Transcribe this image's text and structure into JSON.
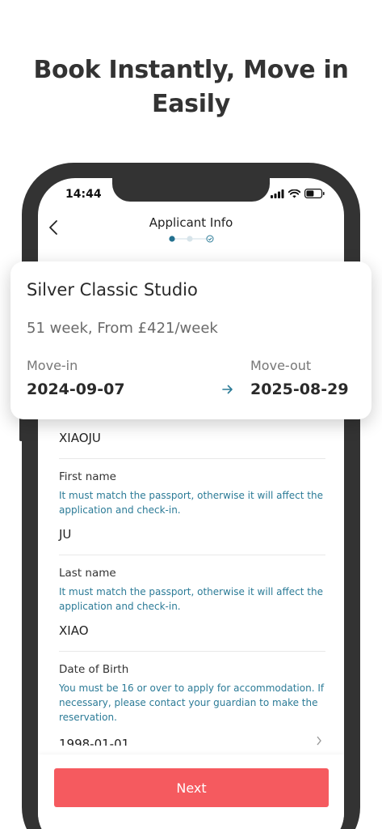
{
  "headline": {
    "line1": "Book Instantly, Move in",
    "line2": "Easily"
  },
  "status_bar": {
    "time": "14:44",
    "icons": [
      "signal-icon",
      "wifi-icon",
      "battery-icon"
    ]
  },
  "nav": {
    "title": "Applicant Info",
    "back_icon": "chevron-left-icon",
    "steps": [
      "step-1-current",
      "step-2",
      "step-3-check"
    ]
  },
  "card": {
    "title": "Silver Classic Studio",
    "subtitle": "51 week, From £421/week",
    "move_in_label": "Move-in",
    "move_in_date": "2024-09-07",
    "move_out_label": "Move-out",
    "move_out_date": "2025-08-29",
    "arrow_icon": "arrow-right-icon"
  },
  "form": {
    "name_value": "XIAOJU",
    "first_name_label": "First name",
    "first_name_hint": "It must match the passport, otherwise it will affect the application and check-in.",
    "first_name_value": "JU",
    "last_name_label": "Last name",
    "last_name_hint": "It must match the passport, otherwise it will affect the application and check-in.",
    "last_name_value": "XIAO",
    "dob_label": "Date of Birth",
    "dob_hint": "You must be 16 or over to apply for accommodation. If necessary, please contact your guardian to make the reservation.",
    "dob_value": "1998-01-01"
  },
  "footer": {
    "next_label": "Next"
  },
  "colors": {
    "accent": "#2c7b97",
    "button": "#f55a5f",
    "phone_frame": "#333333"
  }
}
